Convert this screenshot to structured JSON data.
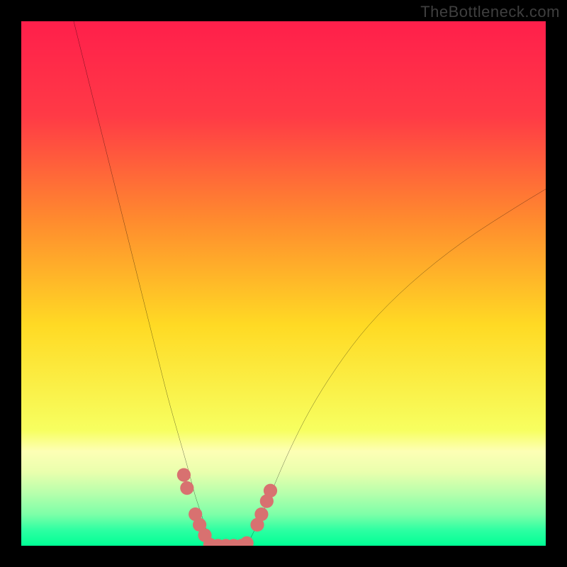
{
  "watermark": "TheBottleneck.com",
  "chart_data": {
    "type": "line",
    "title": "",
    "xlabel": "",
    "ylabel": "",
    "xlim": [
      0,
      100
    ],
    "ylim": [
      0,
      100
    ],
    "background_gradient_stops": [
      {
        "offset": 0.0,
        "color": "#ff1f4b"
      },
      {
        "offset": 0.18,
        "color": "#ff3a46"
      },
      {
        "offset": 0.38,
        "color": "#ff8b2e"
      },
      {
        "offset": 0.58,
        "color": "#ffda24"
      },
      {
        "offset": 0.78,
        "color": "#f7ff60"
      },
      {
        "offset": 0.82,
        "color": "#fdffb5"
      },
      {
        "offset": 0.86,
        "color": "#e9ffad"
      },
      {
        "offset": 0.9,
        "color": "#b7ffac"
      },
      {
        "offset": 0.94,
        "color": "#7dffa8"
      },
      {
        "offset": 0.97,
        "color": "#2effa2"
      },
      {
        "offset": 1.0,
        "color": "#00ff95"
      }
    ],
    "series": [
      {
        "name": "left-curve",
        "stroke": "#000000",
        "x": [
          10,
          12,
          14,
          16,
          18,
          20,
          22,
          24,
          26,
          28,
          30,
          32,
          33,
          34,
          35,
          35.5,
          36
        ],
        "y": [
          100,
          92,
          84,
          76,
          68,
          60,
          52,
          44,
          36,
          28,
          21,
          14,
          10,
          7,
          4,
          2,
          0
        ]
      },
      {
        "name": "right-curve",
        "stroke": "#000000",
        "x": [
          43,
          44,
          46,
          48,
          51,
          55,
          60,
          66,
          74,
          84,
          95,
          100
        ],
        "y": [
          0,
          2,
          6,
          11,
          18,
          26,
          34,
          42,
          50,
          58,
          65,
          68
        ]
      }
    ],
    "markers": {
      "color": "#d87170",
      "radius": 1.3,
      "points": [
        {
          "x": 31.0,
          "y": 13.5
        },
        {
          "x": 31.6,
          "y": 11.0
        },
        {
          "x": 33.2,
          "y": 6.0
        },
        {
          "x": 34.0,
          "y": 4.0
        },
        {
          "x": 35.0,
          "y": 2.0
        },
        {
          "x": 36.0,
          "y": 0.2
        },
        {
          "x": 37.5,
          "y": 0.0
        },
        {
          "x": 39.0,
          "y": 0.0
        },
        {
          "x": 40.5,
          "y": 0.0
        },
        {
          "x": 42.0,
          "y": 0.0
        },
        {
          "x": 43.0,
          "y": 0.5
        },
        {
          "x": 45.0,
          "y": 4.0
        },
        {
          "x": 45.8,
          "y": 6.0
        },
        {
          "x": 46.8,
          "y": 8.5
        },
        {
          "x": 47.5,
          "y": 10.5
        }
      ]
    }
  }
}
